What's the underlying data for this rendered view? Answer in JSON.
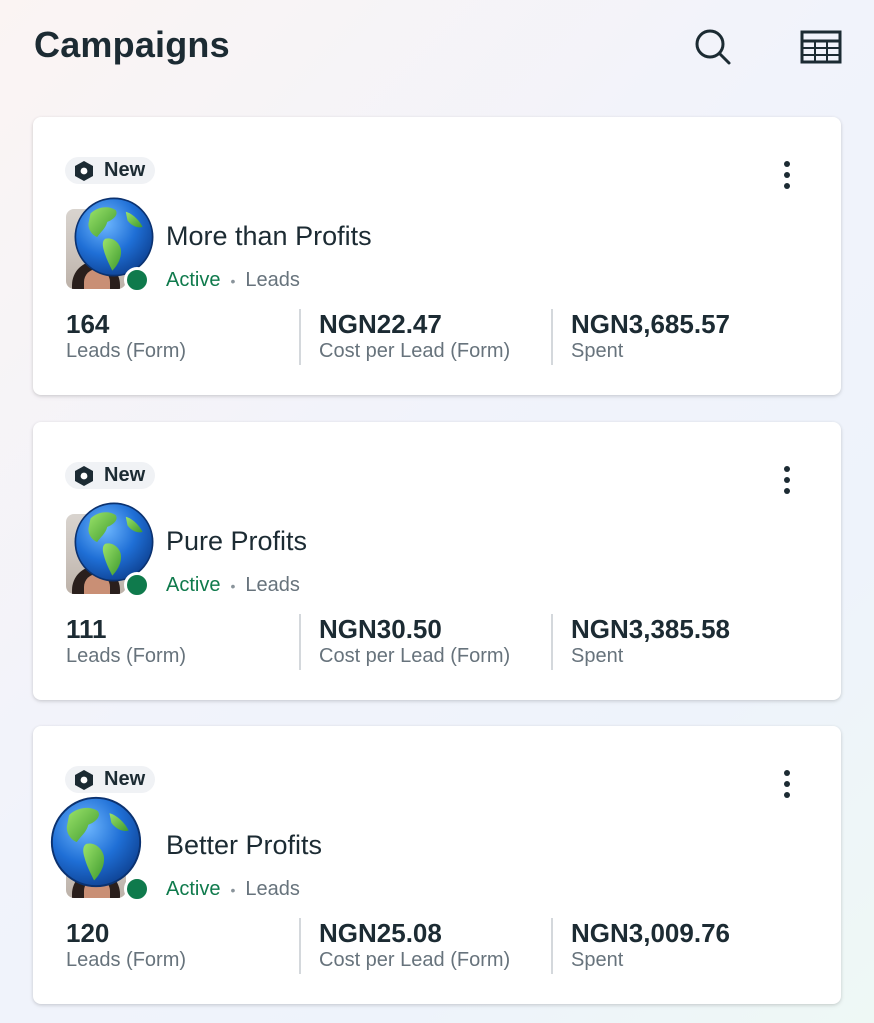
{
  "header": {
    "title": "Campaigns",
    "search_icon": "search-icon",
    "table_icon": "table-view-icon"
  },
  "colors": {
    "active_green": "#0f7a4c",
    "text_primary": "#1c2b33",
    "text_secondary": "#67737c"
  },
  "campaigns": [
    {
      "badge": "New",
      "name": "More than Profits",
      "status": "Active",
      "separator": "•",
      "objective": "Leads",
      "metrics": [
        {
          "value": "164",
          "label": "Leads (Form)"
        },
        {
          "value": "NGN22.47",
          "label": "Cost per Lead (Form)"
        },
        {
          "value": "NGN3,685.57",
          "label": "Spent"
        }
      ]
    },
    {
      "badge": "New",
      "name": "Pure Profits",
      "status": "Active",
      "separator": "•",
      "objective": "Leads",
      "metrics": [
        {
          "value": "111",
          "label": "Leads (Form)"
        },
        {
          "value": "NGN30.50",
          "label": "Cost per Lead (Form)"
        },
        {
          "value": "NGN3,385.58",
          "label": "Spent"
        }
      ]
    },
    {
      "badge": "New",
      "name": "Better Profits",
      "status": "Active",
      "separator": "•",
      "objective": "Leads",
      "metrics": [
        {
          "value": "120",
          "label": "Leads (Form)"
        },
        {
          "value": "NGN25.08",
          "label": "Cost per Lead (Form)"
        },
        {
          "value": "NGN3,009.76",
          "label": "Spent"
        }
      ]
    }
  ]
}
